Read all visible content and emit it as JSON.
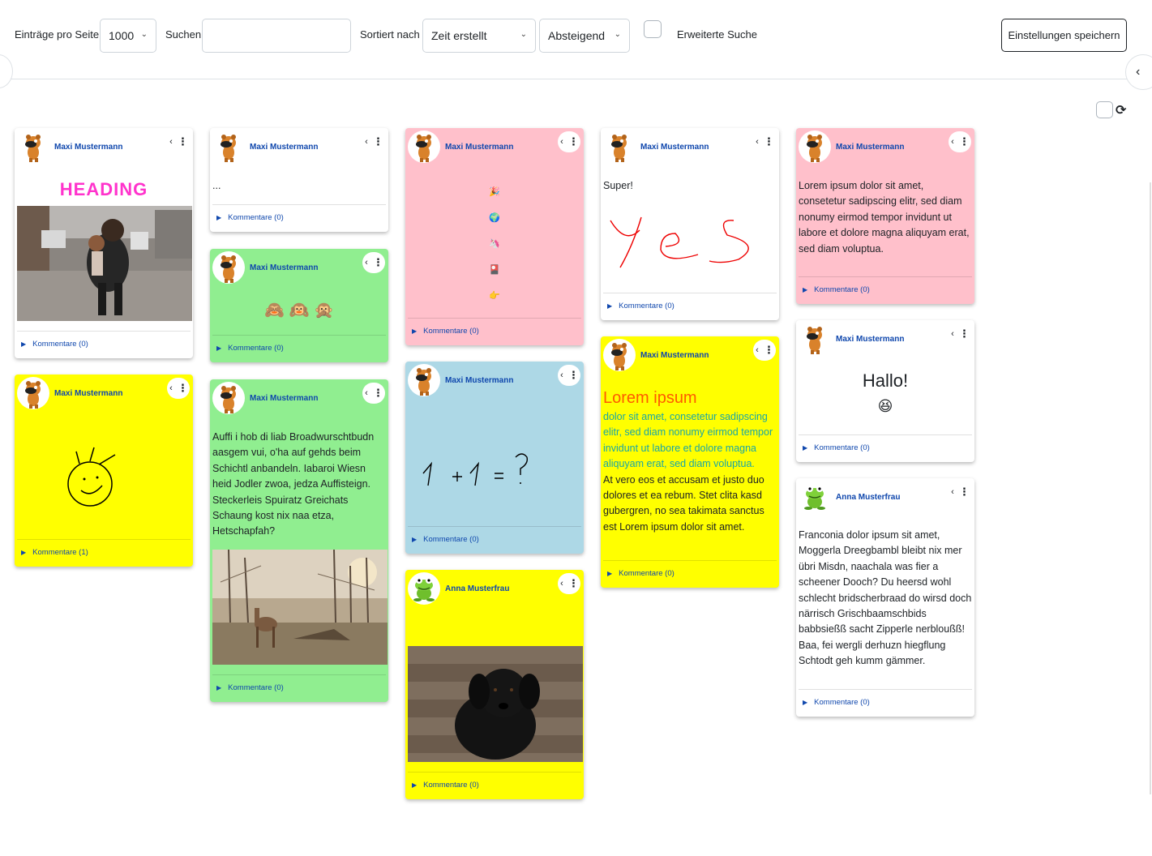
{
  "toolbar": {
    "entries_label": "Einträge pro Seite",
    "entries_value": "1000",
    "search_label": "Suchen",
    "search_value": "",
    "sort_label": "Sortiert nach",
    "sort_value": "Zeit erstellt",
    "order_value": "Absteigend",
    "advanced_label": "Erweiterte Suche",
    "save_label": "Einstellungen speichern"
  },
  "cards": {
    "c1": {
      "author": "Maxi Mustermann",
      "heading": "HEADING",
      "comments": "Kommentare (0)"
    },
    "c2": {
      "author": "Maxi Mustermann",
      "comments": "Kommentare (1)"
    },
    "c3": {
      "author": "Maxi Mustermann",
      "text": "...",
      "comments": "Kommentare (0)"
    },
    "c4": {
      "author": "Maxi Mustermann",
      "emoji": "🙈 🙉 🙊",
      "comments": "Kommentare (0)"
    },
    "c5": {
      "author": "Maxi Mustermann",
      "text": "Auffi i hob di liab Broadwurschtbudn aasgem vui, o'ha auf gehds beim Schichtl anbandeln. Iabaroi Wiesn heid Jodler zwoa, jedza Auffisteign. Steckerleis Spuiratz Greichats Schaung kost nix naa etza, Hetschapfah?",
      "comments": "Kommentare (0)"
    },
    "c6": {
      "author": "Maxi Mustermann",
      "emojis": [
        "🎉",
        "🌍",
        "🦄",
        "🎴",
        "👉"
      ],
      "comments": "Kommentare (0)"
    },
    "c7": {
      "author": "Maxi Mustermann",
      "comments": "Kommentare (0)"
    },
    "c8": {
      "author": "Anna Musterfrau",
      "comments": "Kommentare (0)"
    },
    "c9": {
      "author": "Maxi Mustermann",
      "text": "Super!",
      "comments": "Kommentare (0)"
    },
    "c10": {
      "author": "Maxi Mustermann",
      "heading": "Lorem ipsum",
      "colored_text": "dolor sit amet, consetetur sadipscing elitr, sed diam nonumy eirmod tempor invidunt ut labore et dolore magna aliquyam erat, sed diam voluptua.",
      "text": "At vero eos et accusam et justo duo dolores et ea rebum. Stet clita kasd gubergren, no sea takimata sanctus est Lorem ipsum dolor sit amet.",
      "comments": "Kommentare (0)"
    },
    "c11": {
      "author": "Maxi Mustermann",
      "text": "Lorem ipsum dolor sit amet, consetetur sadipscing elitr, sed diam nonumy eirmod tempor invidunt ut labore et dolore magna aliquyam erat, sed diam voluptua.",
      "comments": "Kommentare (0)"
    },
    "c12": {
      "author": "Maxi Mustermann",
      "heading": "Hallo!",
      "emoji": "😆",
      "comments": "Kommentare (0)"
    },
    "c13": {
      "author": "Anna Musterfrau",
      "text": "Franconia dolor ipsum sit amet, Moggerla Dreegbambl bleibt nix mer übri Misdn, naachala was fier a scheener Dooch? Du heersd wohl schlecht bridscherbraad do wirsd doch närrisch Grischbaamschbids babbsießß sacht Zipperle nerbloußß! Baa, fei wergli derhuzn hiegflung Schtodt geh kumm gämmer.",
      "comments": "Kommentare (0)"
    }
  },
  "colors": {
    "white": "#ffffff",
    "green": "#90ee90",
    "pink": "#ffc0cb",
    "yellow": "#ffff00",
    "blue": "#add8e6",
    "author": "#0f47ad",
    "heading_pink": "#ff33cc",
    "heading_orange": "#ff5a00",
    "text_teal": "#1aa6a6"
  }
}
